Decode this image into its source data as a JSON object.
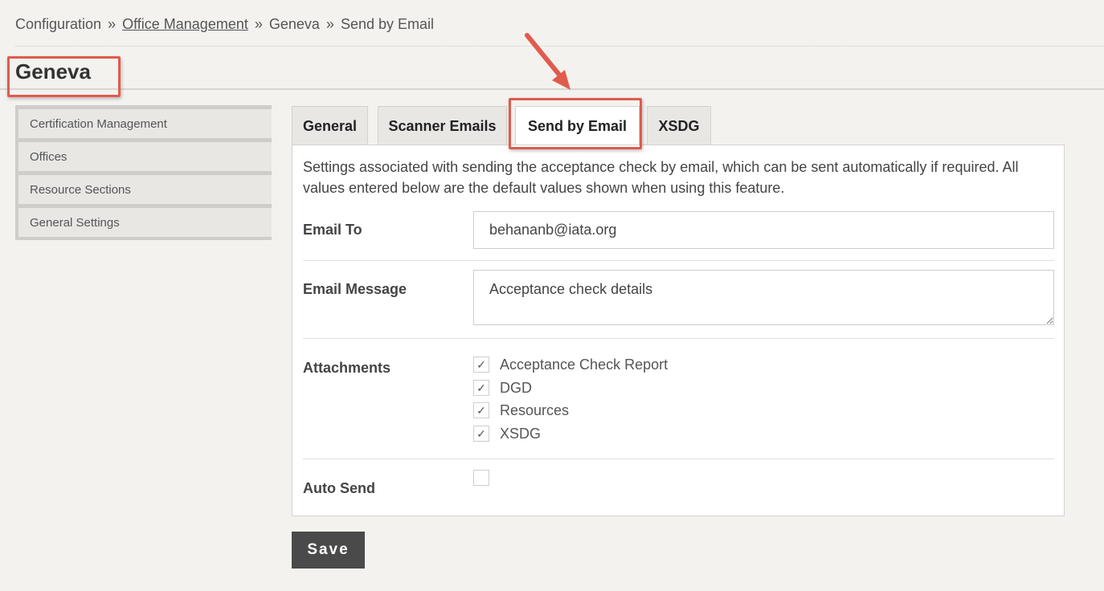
{
  "breadcrumb": {
    "items": [
      "Configuration",
      "Office Management",
      "Geneva",
      "Send by Email"
    ],
    "separator": "»"
  },
  "page": {
    "title": "Geneva"
  },
  "sidebar": {
    "items": [
      {
        "label": "Certification Management"
      },
      {
        "label": "Offices"
      },
      {
        "label": "Resource Sections"
      },
      {
        "label": "General Settings"
      }
    ]
  },
  "tabs": [
    {
      "label": "General",
      "active": false
    },
    {
      "label": "Scanner Emails",
      "active": false
    },
    {
      "label": "Send by Email",
      "active": true
    },
    {
      "label": "XSDG",
      "active": false
    }
  ],
  "form": {
    "description": "Settings associated with sending the acceptance check by email, which can be sent automatically if required. All values entered below are the default values shown when using this feature.",
    "email_to": {
      "label": "Email To",
      "value": "behananb@iata.org"
    },
    "email_message": {
      "label": "Email Message",
      "value": "Acceptance check details"
    },
    "attachments": {
      "label": "Attachments",
      "items": [
        {
          "label": "Acceptance Check Report",
          "checked": true
        },
        {
          "label": "DGD",
          "checked": true
        },
        {
          "label": "Resources",
          "checked": true
        },
        {
          "label": "XSDG",
          "checked": true
        }
      ]
    },
    "auto_send": {
      "label": "Auto Send",
      "checked": false
    }
  },
  "actions": {
    "save_label": "Save"
  },
  "colors": {
    "accent_highlight": "#e15b4c",
    "button_bg": "#4a4a4a",
    "page_bg": "#f3f2ef"
  }
}
